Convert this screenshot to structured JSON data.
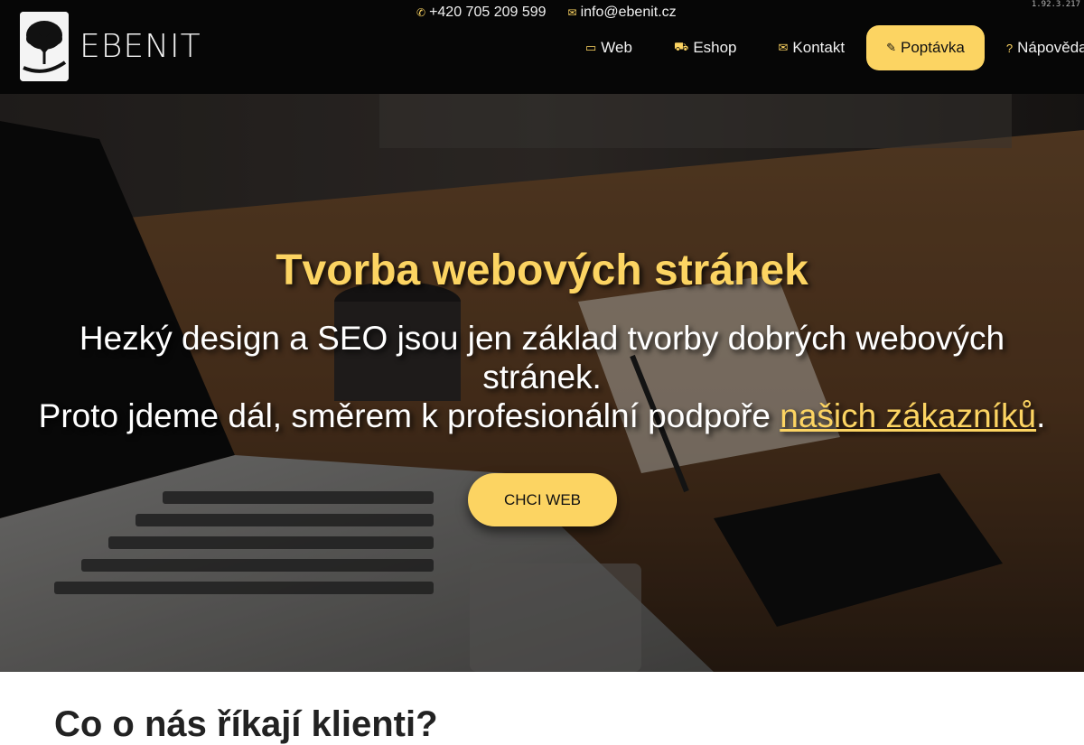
{
  "brand": {
    "name": "EBENIT",
    "logo_icon": "tree-icon"
  },
  "contact": {
    "phone_icon": "phone-icon",
    "phone": "+420 705 209 599",
    "email_icon": "envelope-icon",
    "email": "info@ebenit.cz"
  },
  "version": "1.92.3.217",
  "nav": {
    "items": [
      {
        "label": "Web",
        "icon": "desktop-icon",
        "active": true
      },
      {
        "label": "Eshop",
        "icon": "cart-icon"
      },
      {
        "label": "Kontakt",
        "icon": "envelope-icon"
      },
      {
        "label": "Poptávka",
        "icon": "edit-icon",
        "highlight": true
      },
      {
        "label": "Nápověda",
        "icon": "question-icon"
      }
    ]
  },
  "hero": {
    "title": "Tvorba webových stránek",
    "subtitle_line1": "Hezký design a SEO jsou jen základ tvorby dobrých webových stránek.",
    "subtitle_line2_prefix": "Proto jdeme dál, směrem k profesionální podpoře ",
    "subtitle_line2_link": "našich zákazníků",
    "subtitle_line2_suffix": ".",
    "cta_label": "CHCI WEB"
  },
  "testimonials": {
    "title": "Co o nás říkají klienti?"
  },
  "colors": {
    "accent": "#fcd462",
    "header_bg": "#060606"
  }
}
